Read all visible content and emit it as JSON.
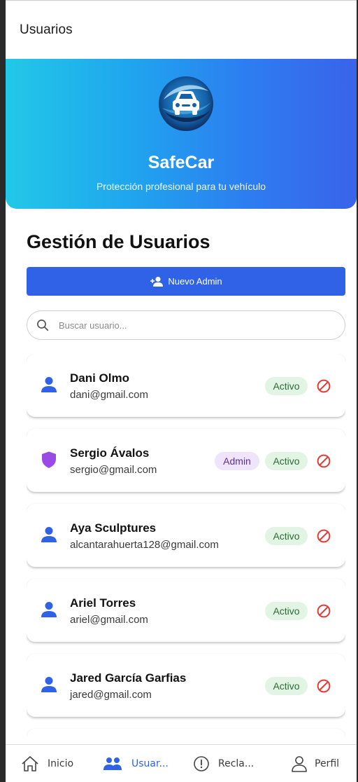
{
  "appbar": {
    "title": "Usuarios"
  },
  "hero": {
    "brand": "SafeCar",
    "tagline": "Protección profesional para tu vehículo"
  },
  "page": {
    "title": "Gestión de Usuarios"
  },
  "actions": {
    "new_admin_label": "Nuevo Admin"
  },
  "search": {
    "placeholder": "Buscar usuario...",
    "value": ""
  },
  "users": [
    {
      "name": "Dani Olmo",
      "email": "dani@gmail.com",
      "role_icon": "person-icon",
      "admin_badge": "",
      "status": "Activo"
    },
    {
      "name": "Sergio Ávalos",
      "email": "sergio@gmail.com",
      "role_icon": "shield-icon",
      "admin_badge": "Admin",
      "status": "Activo"
    },
    {
      "name": "Aya Sculptures",
      "email": "alcantarahuerta128@gmail.com",
      "role_icon": "person-icon",
      "admin_badge": "",
      "status": "Activo"
    },
    {
      "name": "Ariel Torres",
      "email": "ariel@gmail.com",
      "role_icon": "person-icon",
      "admin_badge": "",
      "status": "Activo"
    },
    {
      "name": "Jared García Garfias",
      "email": "jared@gmail.com",
      "role_icon": "person-icon",
      "admin_badge": "",
      "status": "Activo"
    }
  ],
  "bottom_nav": [
    {
      "label": "Inicio",
      "icon": "home-icon",
      "active": false
    },
    {
      "label": "Usuar...",
      "icon": "users-icon",
      "active": true
    },
    {
      "label": "Recla...",
      "icon": "alert-circle-icon",
      "active": false
    },
    {
      "label": "Perfil",
      "icon": "profile-icon",
      "active": false
    }
  ],
  "colors": {
    "primary": "#2f62e6",
    "hero_gradient_start": "#22c8e8",
    "hero_gradient_end": "#3a63ea",
    "user_icon": "#2f62e6",
    "admin_icon": "#9a4be6",
    "active_badge_bg": "#e2f4e4",
    "admin_badge_bg": "#efe4fb",
    "block_icon": "#e53935"
  }
}
